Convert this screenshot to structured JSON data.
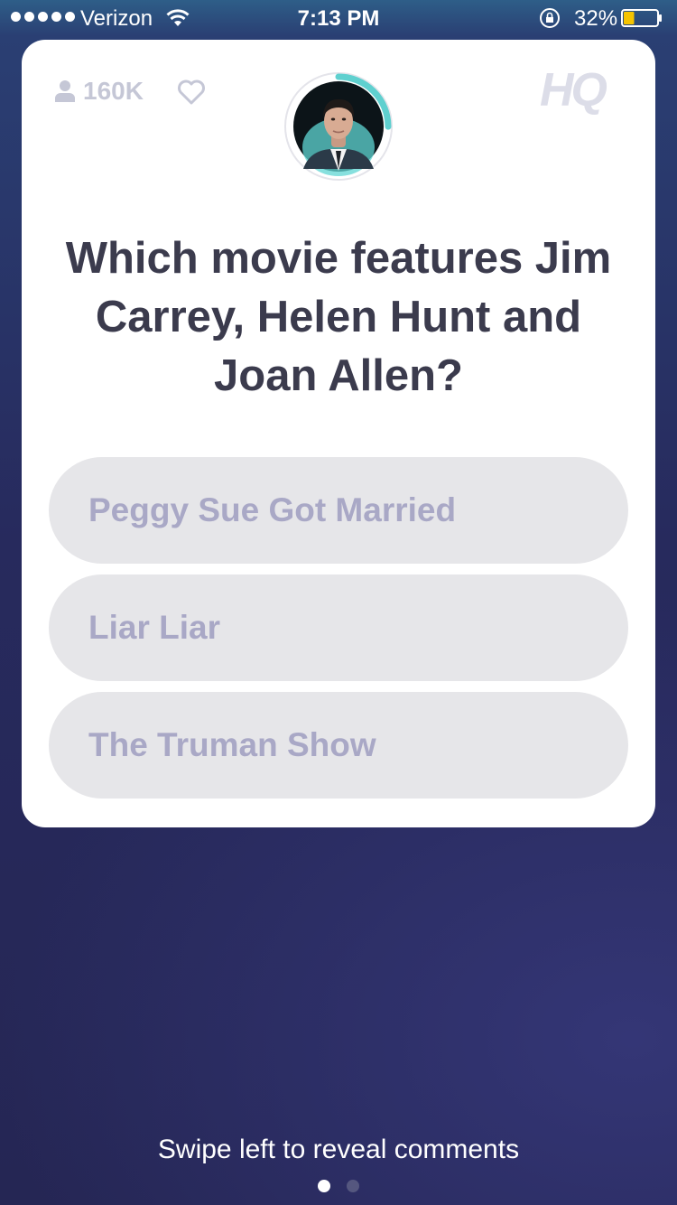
{
  "status_bar": {
    "carrier": "Verizon",
    "time": "7:13 PM",
    "battery_percent": "32%",
    "battery_level": 0.32
  },
  "card": {
    "viewer_count": "160K",
    "logo_text": "HQ",
    "host_timer_progress": 0.25,
    "question": "Which movie features Jim Carrey, Helen Hunt and Joan Allen?",
    "answers": [
      {
        "label": "Peggy Sue Got Married"
      },
      {
        "label": "Liar Liar"
      },
      {
        "label": "The Truman Show"
      }
    ]
  },
  "footer": {
    "hint": "Swipe left to reveal comments",
    "page_index": 0,
    "page_count": 2
  },
  "colors": {
    "accent_timer": "#5fd0cf",
    "answer_bg": "#e6e6e9",
    "answer_text": "#a9a8c6",
    "battery_fill": "#f5c400"
  }
}
